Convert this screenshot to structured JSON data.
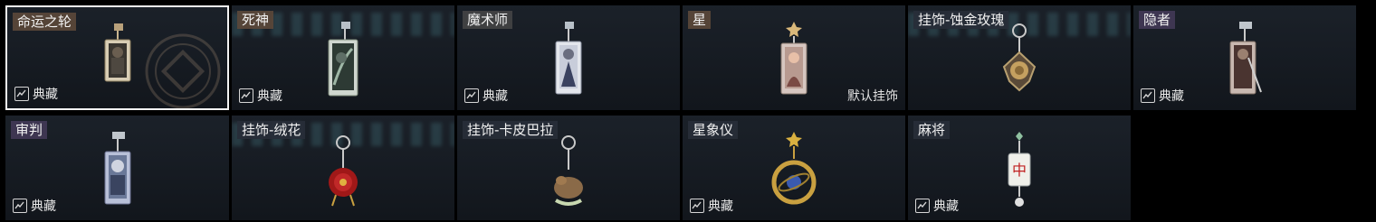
{
  "cards": [
    {
      "name": "命运之轮",
      "collect_label": "典藏",
      "default_label": "",
      "selected": true
    },
    {
      "name": "死神",
      "collect_label": "典藏",
      "default_label": ""
    },
    {
      "name": "魔术师",
      "collect_label": "典藏",
      "default_label": ""
    },
    {
      "name": "星",
      "collect_label": "",
      "default_label": "默认挂饰"
    },
    {
      "name": "挂饰-蚀金玫瑰",
      "collect_label": "",
      "default_label": ""
    },
    {
      "name": "隐者",
      "collect_label": "典藏",
      "default_label": ""
    },
    {
      "name": "审判",
      "collect_label": "典藏",
      "default_label": ""
    },
    {
      "name": "挂饰-绒花",
      "collect_label": "",
      "default_label": ""
    },
    {
      "name": "挂饰-卡皮巴拉",
      "collect_label": "",
      "default_label": ""
    },
    {
      "name": "星象仪",
      "collect_label": "典藏",
      "default_label": ""
    },
    {
      "name": "麻将",
      "collect_label": "典藏",
      "default_label": ""
    }
  ]
}
